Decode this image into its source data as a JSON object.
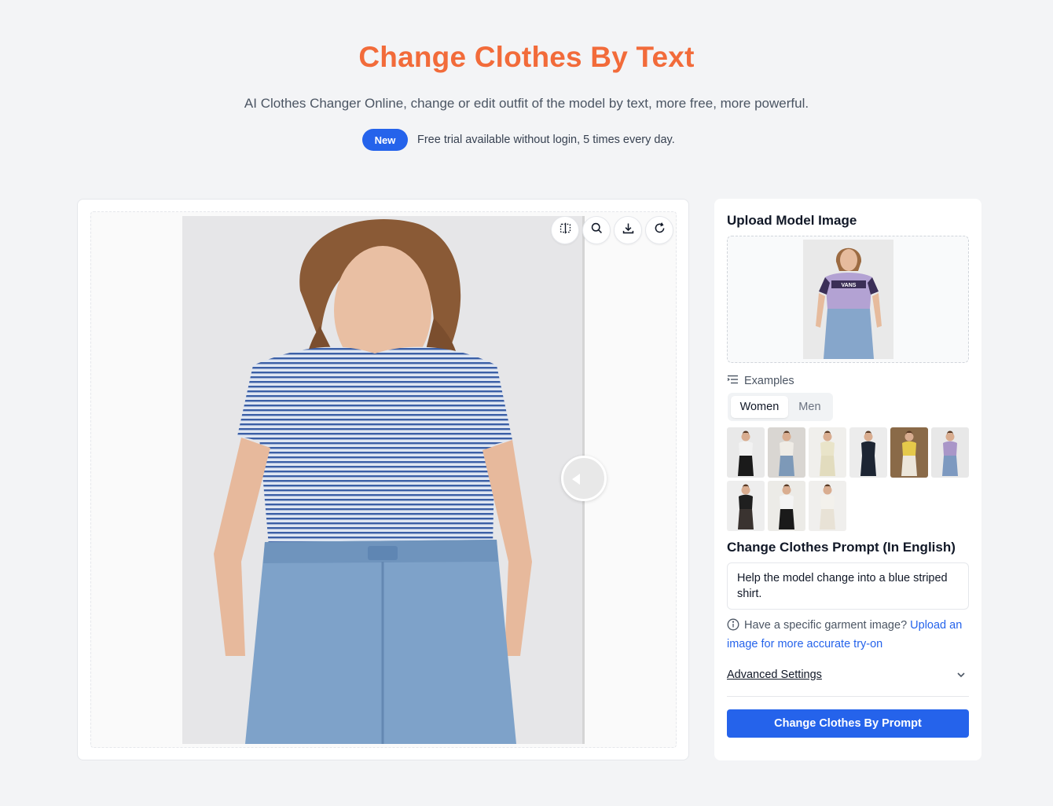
{
  "header": {
    "title": "Change Clothes By Text",
    "subtitle": "AI Clothes Changer Online, change or edit outfit of the model by text, more free, more powerful.",
    "badge": "New",
    "notice": "Free trial available without login, 5 times every day."
  },
  "toolbar": {
    "icons": [
      "compare-icon",
      "zoom-icon",
      "download-icon",
      "refresh-icon"
    ]
  },
  "panel": {
    "upload_label": "Upload Model Image",
    "examples_label": "Examples",
    "tabs": [
      {
        "label": "Women",
        "active": true
      },
      {
        "label": "Men",
        "active": false
      }
    ],
    "example_thumbs": [
      {
        "name": "example-1",
        "top": "#f2f2f2",
        "bottom": "#1a1a1a",
        "bg": "#e9e9e9"
      },
      {
        "name": "example-2",
        "top": "#efece6",
        "bottom": "#7d99b8",
        "bg": "#d9d6d2"
      },
      {
        "name": "example-3",
        "top": "#e9e4c9",
        "bottom": "#e2dcbe",
        "bg": "#f0efec"
      },
      {
        "name": "example-4",
        "top": "#1d2533",
        "bottom": "#1d2533",
        "bg": "#ececec"
      },
      {
        "name": "example-5",
        "top": "#e5c94a",
        "bottom": "#ece6da",
        "bg": "#8a6a48"
      },
      {
        "name": "example-6",
        "top": "#a996c8",
        "bottom": "#7d99c0",
        "bg": "#e8e8e8"
      },
      {
        "name": "example-7",
        "top": "#1f1f1f",
        "bottom": "#3a3330",
        "bg": "#eeeeee"
      },
      {
        "name": "example-8",
        "top": "#f4f4f4",
        "bottom": "#1a1a1a",
        "bg": "#ecebe7"
      },
      {
        "name": "example-9",
        "top": "#f3f1ec",
        "bottom": "#e8e2d6",
        "bg": "#f0efed"
      }
    ],
    "prompt_label": "Change Clothes Prompt (In English)",
    "prompt_value": "Help the model change into a blue striped shirt.",
    "hint_text": "Have a specific garment image? ",
    "hint_link": "Upload an image for more accurate try-on",
    "advanced_label": "Advanced Settings",
    "cta_label": "Change Clothes By Prompt"
  },
  "colors": {
    "accent": "#2563eb",
    "title": "#f26b3a"
  }
}
